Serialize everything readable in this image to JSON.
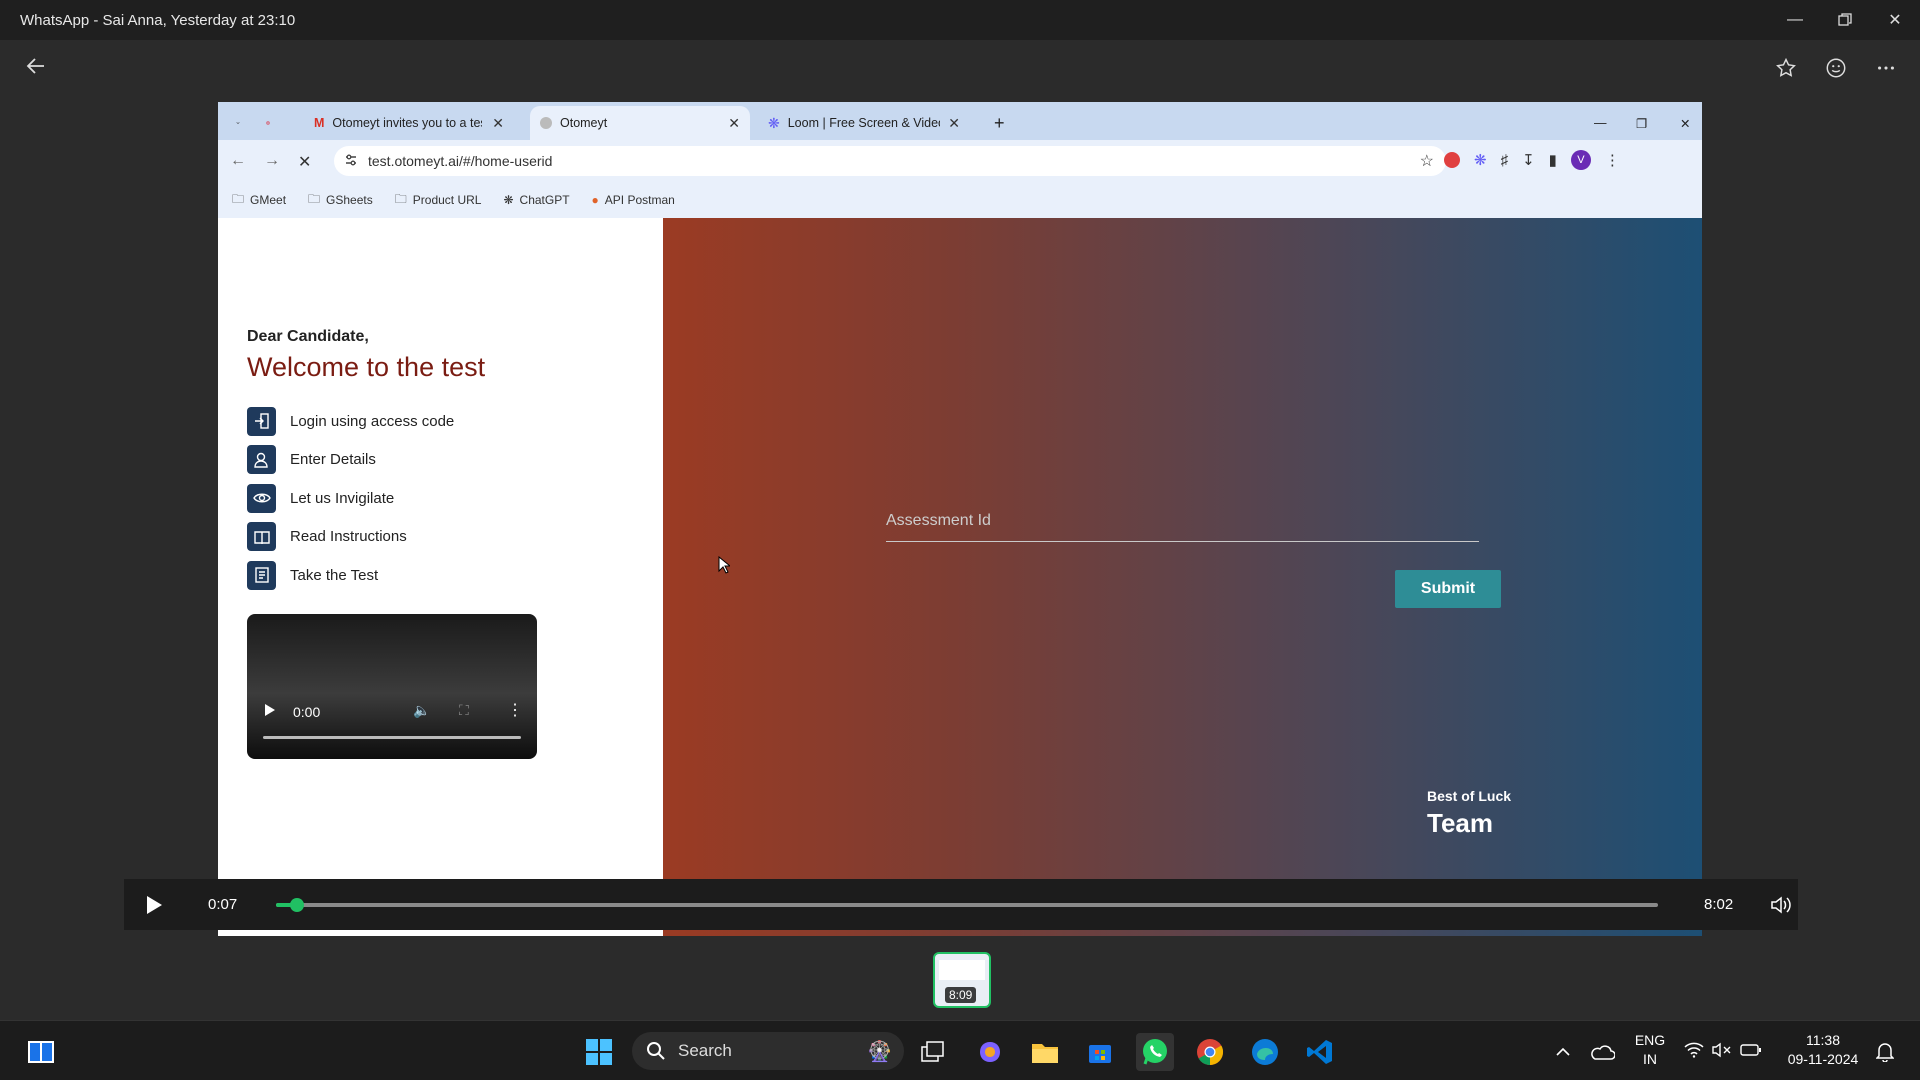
{
  "window": {
    "title": "WhatsApp - Sai Anna, Yesterday at 23:10"
  },
  "browser": {
    "tabs": [
      {
        "label": "Otomeyt invites you to a test at",
        "active": false
      },
      {
        "label": "Otomeyt",
        "active": true
      },
      {
        "label": "Loom | Free Screen & Video Re",
        "active": false
      }
    ],
    "url": "test.otomeyt.ai/#/home-userid",
    "profile_initial": "V",
    "bookmarks": [
      "GMeet",
      "GSheets",
      "Product URL",
      "ChatGPT",
      "API Postman"
    ]
  },
  "page": {
    "greeting": "Dear Candidate,",
    "heading": "Welcome to the test",
    "steps": [
      {
        "label": "Login using access code",
        "icon": "login-icon"
      },
      {
        "label": "Enter Details",
        "icon": "user-details-icon"
      },
      {
        "label": "Let us Invigilate",
        "icon": "eye-icon"
      },
      {
        "label": "Read Instructions",
        "icon": "book-icon"
      },
      {
        "label": "Take the Test",
        "icon": "test-sheet-icon"
      }
    ],
    "video_time": "0:00",
    "assessment_placeholder": "Assessment Id",
    "submit_label": "Submit",
    "closing_line": "Best of Luck",
    "signature": "Team"
  },
  "player": {
    "current_time": "0:07",
    "duration": "8:02",
    "progress_fraction": 0.015
  },
  "thumbnail": {
    "duration": "8:09"
  },
  "taskbar": {
    "search_label": "Search",
    "language_line1": "ENG",
    "language_line2": "IN",
    "time": "11:38",
    "date": "09-11-2024"
  },
  "colors": {
    "accent_green": "#21c063",
    "heading_red": "#7a1c12",
    "submit_teal": "#2e8d96",
    "step_icon_navy": "#1f3a5c"
  }
}
